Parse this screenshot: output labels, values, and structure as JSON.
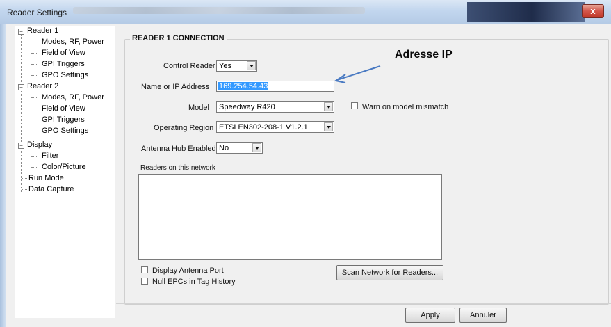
{
  "window": {
    "title": "Reader Settings",
    "close_glyph": "x"
  },
  "tree": {
    "reader1": "Reader 1",
    "reader1_children": [
      "Modes, RF, Power",
      "Field of View",
      "GPI Triggers",
      "GPO Settings"
    ],
    "reader2": "Reader 2",
    "reader2_children": [
      "Modes, RF, Power",
      "Field of View",
      "GPI Triggers",
      "GPO Settings"
    ],
    "display": "Display",
    "display_children": [
      "Filter",
      "Color/Picture"
    ],
    "run_mode": "Run Mode",
    "data_capture": "Data Capture"
  },
  "section": {
    "title": "READER 1 CONNECTION",
    "control_reader_label": "Control Reader",
    "control_reader_value": "Yes",
    "name_ip_label": "Name or IP Address",
    "name_ip_value": "169.254.54.43",
    "model_label": "Model",
    "model_value": "Speedway R420",
    "warn_label": "Warn on model mismatch",
    "region_label": "Operating Region",
    "region_value": "ETSI EN302-208-1 V1.2.1",
    "hub_label": "Antenna Hub Enabled",
    "hub_value": "No",
    "readers_label": "Readers on this network",
    "display_port_label": "Display Antenna Port",
    "null_epcs_label": "Null EPCs in Tag History",
    "scan_button": "Scan Network for Readers..."
  },
  "annotation": {
    "text": "Adresse IP",
    "arrow_color": "#4a7ac2"
  },
  "footer": {
    "apply": "Apply",
    "cancel": "Annuler"
  },
  "icons": {
    "expander": "minus-box-icon",
    "dropdown": "chevron-down-icon"
  }
}
